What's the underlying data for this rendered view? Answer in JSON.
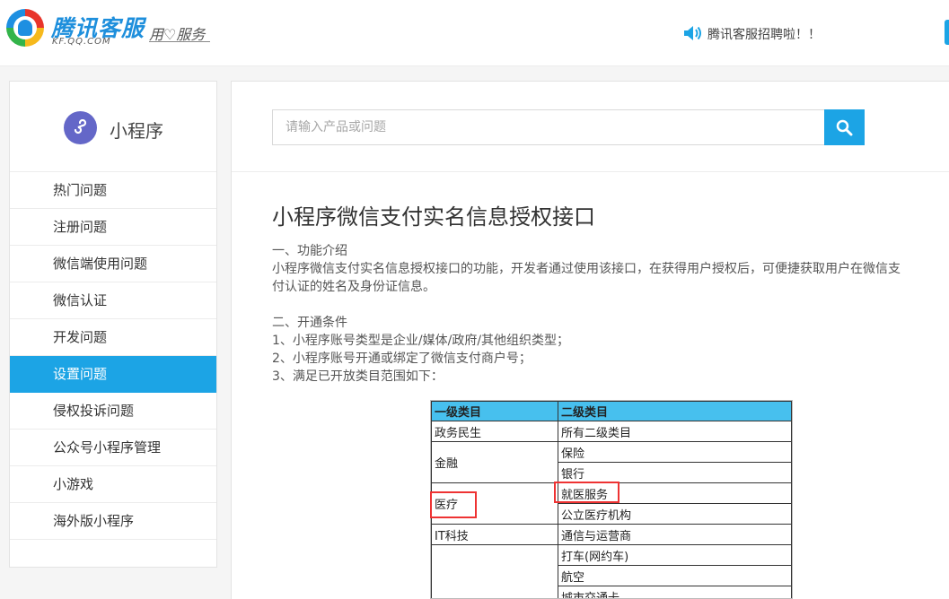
{
  "header": {
    "logo_text": "腾讯客服",
    "logo_sub": "KF.QQ.COM",
    "slogan": "用♡服务",
    "notice_icon": "speaker-icon",
    "notice": "腾讯客服招聘啦！！"
  },
  "sidebar": {
    "title": "小程序",
    "icon": "mini-program-icon",
    "items": [
      {
        "label": "热门问题"
      },
      {
        "label": "注册问题"
      },
      {
        "label": "微信端使用问题"
      },
      {
        "label": "微信认证"
      },
      {
        "label": "开发问题"
      },
      {
        "label": "设置问题",
        "active": true
      },
      {
        "label": "侵权投诉问题"
      },
      {
        "label": "公众号小程序管理"
      },
      {
        "label": "小游戏"
      },
      {
        "label": "海外版小程序"
      }
    ]
  },
  "search": {
    "placeholder": "请输入产品或问题",
    "button_icon": "search-icon"
  },
  "article": {
    "title": "小程序微信支付实名信息授权接口",
    "lines": [
      "一、功能介绍",
      "小程序微信支付实名信息授权接口的功能，开发者通过使用该接口，在获得用户授权后，可便捷获取用户在微信支",
      "付认证的姓名及身份证信息。",
      "二、开通条件",
      "1、小程序账号类型是企业/媒体/政府/其他组织类型；",
      "2、小程序账号开通或绑定了微信支付商户号；",
      "3、满足已开放类目范围如下："
    ]
  },
  "table": {
    "headers": [
      "一级类目",
      "二级类目"
    ],
    "rows": [
      {
        "primary": "政务民生",
        "secondary": [
          "所有二级类目"
        ]
      },
      {
        "primary": "金融",
        "secondary": [
          "保险",
          "银行"
        ]
      },
      {
        "primary": "医疗",
        "secondary": [
          "就医服务",
          "公立医疗机构"
        ]
      },
      {
        "primary": "IT科技",
        "secondary": [
          "通信与运营商"
        ]
      },
      {
        "primary": "",
        "secondary": [
          "打车(网约车)",
          "航空",
          "城市交通卡"
        ]
      }
    ]
  },
  "colors": {
    "accent": "#1ca4e5",
    "table_header": "#47c0ee",
    "highlight": "#e33333"
  }
}
